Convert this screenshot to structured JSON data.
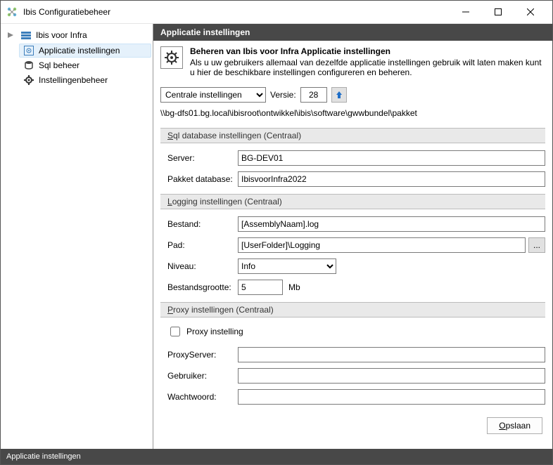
{
  "window": {
    "title": "Ibis Configuratiebeheer"
  },
  "tree": {
    "root": "Ibis voor Infra",
    "items": [
      {
        "label": "Applicatie instellingen",
        "selected": true
      },
      {
        "label": "Sql beheer",
        "selected": false
      },
      {
        "label": "Instellingenbeheer",
        "selected": false
      }
    ]
  },
  "page": {
    "title_bar": "Applicatie instellingen",
    "header_title": "Beheren van Ibis voor Infra Applicatie instellingen",
    "header_sub": "Als u uw gebruikers allemaal van dezelfde applicatie instellingen gebruik wilt laten maken kunt u hier de beschikbare instellingen configureren en beheren.",
    "central_combo": "Centrale instellingen",
    "versie_label": "Versie:",
    "versie_value": "28",
    "path": "\\\\bg-dfs01.bg.local\\ibisroot\\ontwikkel\\ibis\\software\\gwwbundel\\pakket"
  },
  "sql": {
    "heading_u": "S",
    "heading_rest": "ql database instellingen  (Centraal)",
    "server_label": "Server:",
    "server_value": "BG-DEV01",
    "db_label": "Pakket database:",
    "db_value": "IbisvoorInfra2022"
  },
  "log": {
    "heading_u": "L",
    "heading_rest": "ogging instellingen  (Centraal)",
    "bestand_label": "Bestand:",
    "bestand_value": "[AssemblyNaam].log",
    "pad_label": "Pad:",
    "pad_value": "[UserFolder]\\Logging",
    "niveau_label": "Niveau:",
    "niveau_value": "Info",
    "size_label": "Bestandsgrootte:",
    "size_value": "5",
    "size_unit": "Mb",
    "browse": "..."
  },
  "proxy": {
    "heading_u": "P",
    "heading_rest": "roxy instellingen  (Centraal)",
    "chk_label": "Proxy instelling",
    "server_label": "ProxyServer:",
    "server_value": "",
    "user_label": "Gebruiker:",
    "user_value": "",
    "pass_label": "Wachtwoord:",
    "pass_value": ""
  },
  "buttons": {
    "save": "Opslaan"
  },
  "status": "Applicatie instellingen"
}
